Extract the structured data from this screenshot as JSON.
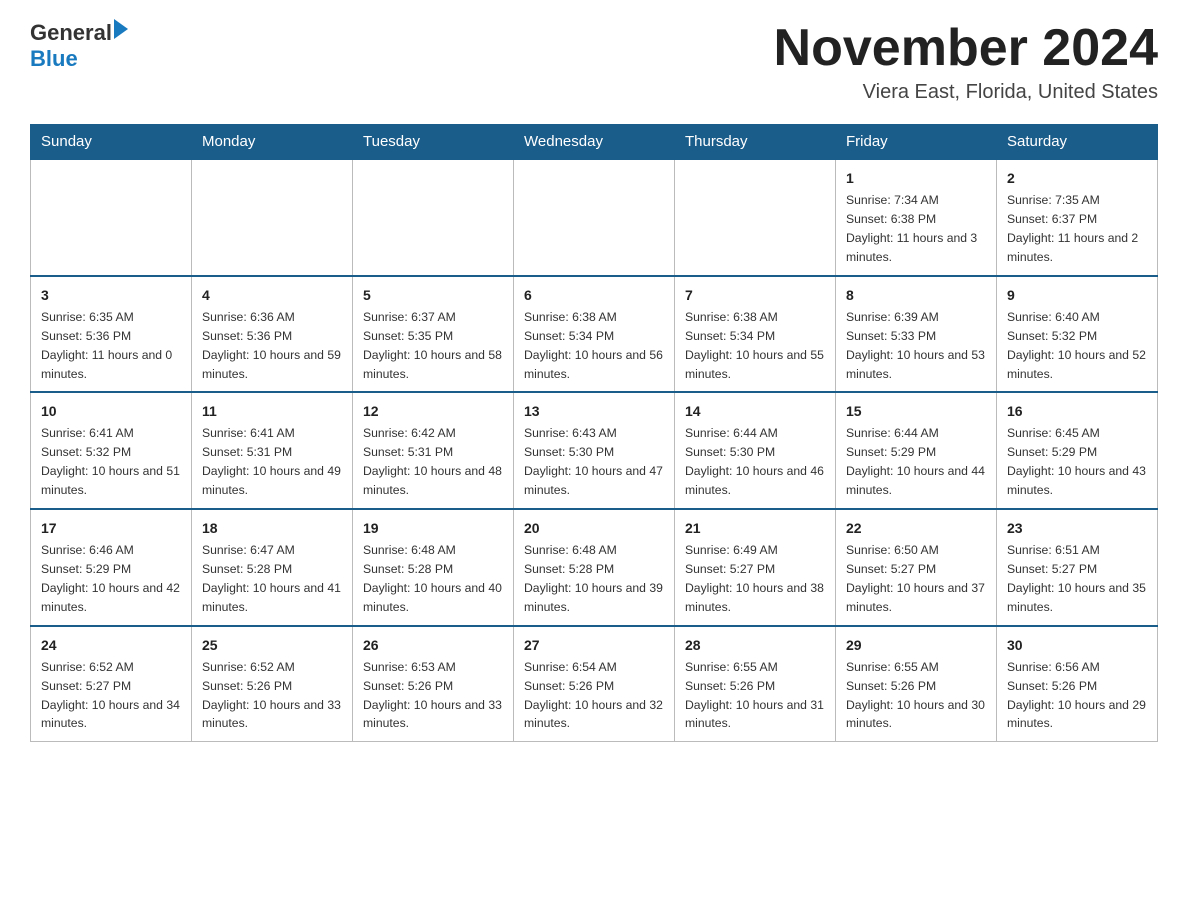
{
  "header": {
    "logo_general": "General",
    "logo_blue": "Blue",
    "month_title": "November 2024",
    "location": "Viera East, Florida, United States"
  },
  "weekdays": [
    "Sunday",
    "Monday",
    "Tuesday",
    "Wednesday",
    "Thursday",
    "Friday",
    "Saturday"
  ],
  "weeks": [
    [
      {
        "day": "",
        "info": ""
      },
      {
        "day": "",
        "info": ""
      },
      {
        "day": "",
        "info": ""
      },
      {
        "day": "",
        "info": ""
      },
      {
        "day": "",
        "info": ""
      },
      {
        "day": "1",
        "info": "Sunrise: 7:34 AM\nSunset: 6:38 PM\nDaylight: 11 hours and 3 minutes."
      },
      {
        "day": "2",
        "info": "Sunrise: 7:35 AM\nSunset: 6:37 PM\nDaylight: 11 hours and 2 minutes."
      }
    ],
    [
      {
        "day": "3",
        "info": "Sunrise: 6:35 AM\nSunset: 5:36 PM\nDaylight: 11 hours and 0 minutes."
      },
      {
        "day": "4",
        "info": "Sunrise: 6:36 AM\nSunset: 5:36 PM\nDaylight: 10 hours and 59 minutes."
      },
      {
        "day": "5",
        "info": "Sunrise: 6:37 AM\nSunset: 5:35 PM\nDaylight: 10 hours and 58 minutes."
      },
      {
        "day": "6",
        "info": "Sunrise: 6:38 AM\nSunset: 5:34 PM\nDaylight: 10 hours and 56 minutes."
      },
      {
        "day": "7",
        "info": "Sunrise: 6:38 AM\nSunset: 5:34 PM\nDaylight: 10 hours and 55 minutes."
      },
      {
        "day": "8",
        "info": "Sunrise: 6:39 AM\nSunset: 5:33 PM\nDaylight: 10 hours and 53 minutes."
      },
      {
        "day": "9",
        "info": "Sunrise: 6:40 AM\nSunset: 5:32 PM\nDaylight: 10 hours and 52 minutes."
      }
    ],
    [
      {
        "day": "10",
        "info": "Sunrise: 6:41 AM\nSunset: 5:32 PM\nDaylight: 10 hours and 51 minutes."
      },
      {
        "day": "11",
        "info": "Sunrise: 6:41 AM\nSunset: 5:31 PM\nDaylight: 10 hours and 49 minutes."
      },
      {
        "day": "12",
        "info": "Sunrise: 6:42 AM\nSunset: 5:31 PM\nDaylight: 10 hours and 48 minutes."
      },
      {
        "day": "13",
        "info": "Sunrise: 6:43 AM\nSunset: 5:30 PM\nDaylight: 10 hours and 47 minutes."
      },
      {
        "day": "14",
        "info": "Sunrise: 6:44 AM\nSunset: 5:30 PM\nDaylight: 10 hours and 46 minutes."
      },
      {
        "day": "15",
        "info": "Sunrise: 6:44 AM\nSunset: 5:29 PM\nDaylight: 10 hours and 44 minutes."
      },
      {
        "day": "16",
        "info": "Sunrise: 6:45 AM\nSunset: 5:29 PM\nDaylight: 10 hours and 43 minutes."
      }
    ],
    [
      {
        "day": "17",
        "info": "Sunrise: 6:46 AM\nSunset: 5:29 PM\nDaylight: 10 hours and 42 minutes."
      },
      {
        "day": "18",
        "info": "Sunrise: 6:47 AM\nSunset: 5:28 PM\nDaylight: 10 hours and 41 minutes."
      },
      {
        "day": "19",
        "info": "Sunrise: 6:48 AM\nSunset: 5:28 PM\nDaylight: 10 hours and 40 minutes."
      },
      {
        "day": "20",
        "info": "Sunrise: 6:48 AM\nSunset: 5:28 PM\nDaylight: 10 hours and 39 minutes."
      },
      {
        "day": "21",
        "info": "Sunrise: 6:49 AM\nSunset: 5:27 PM\nDaylight: 10 hours and 38 minutes."
      },
      {
        "day": "22",
        "info": "Sunrise: 6:50 AM\nSunset: 5:27 PM\nDaylight: 10 hours and 37 minutes."
      },
      {
        "day": "23",
        "info": "Sunrise: 6:51 AM\nSunset: 5:27 PM\nDaylight: 10 hours and 35 minutes."
      }
    ],
    [
      {
        "day": "24",
        "info": "Sunrise: 6:52 AM\nSunset: 5:27 PM\nDaylight: 10 hours and 34 minutes."
      },
      {
        "day": "25",
        "info": "Sunrise: 6:52 AM\nSunset: 5:26 PM\nDaylight: 10 hours and 33 minutes."
      },
      {
        "day": "26",
        "info": "Sunrise: 6:53 AM\nSunset: 5:26 PM\nDaylight: 10 hours and 33 minutes."
      },
      {
        "day": "27",
        "info": "Sunrise: 6:54 AM\nSunset: 5:26 PM\nDaylight: 10 hours and 32 minutes."
      },
      {
        "day": "28",
        "info": "Sunrise: 6:55 AM\nSunset: 5:26 PM\nDaylight: 10 hours and 31 minutes."
      },
      {
        "day": "29",
        "info": "Sunrise: 6:55 AM\nSunset: 5:26 PM\nDaylight: 10 hours and 30 minutes."
      },
      {
        "day": "30",
        "info": "Sunrise: 6:56 AM\nSunset: 5:26 PM\nDaylight: 10 hours and 29 minutes."
      }
    ]
  ]
}
